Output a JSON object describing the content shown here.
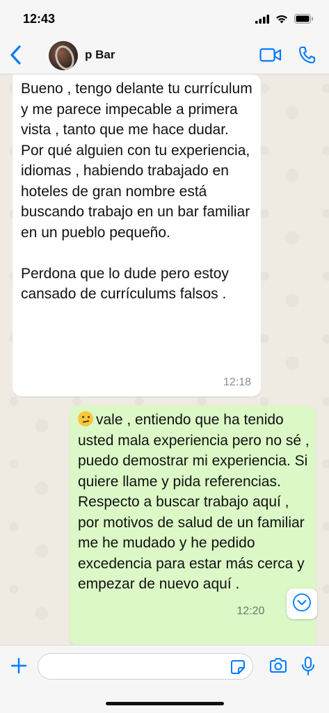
{
  "status_bar": {
    "time": "12:43"
  },
  "header": {
    "contact_name": "p Bar"
  },
  "messages": [
    {
      "direction": "incoming",
      "text": "Bueno , tengo delante tu currículum y me parece impecable a primera vista , tanto que me hace dudar.\nPor qué alguien con tu experiencia, idiomas , habiendo trabajado en hoteles de gran nombre está buscando trabajo en un bar familiar en un pueblo pequeño.\n\nPerdona que lo dude pero estoy cansado de currículums falsos .",
      "time": "12:18"
    },
    {
      "direction": "outgoing",
      "emoji": "confused-face",
      "text": "vale , entiendo que ha tenido usted mala experiencia pero no sé , puedo demostrar mi experiencia. Si quiere llame y pida referencias.\nRespecto a buscar trabajo aquí , por motivos de salud de un familiar me he mudado y he pedido excedencia para estar más cerca y empezar de nuevo aquí .",
      "time": "12:20",
      "status": "read-double-check"
    }
  ],
  "composer": {
    "value": "",
    "placeholder": ""
  },
  "colors": {
    "accent": "#007aff",
    "outgoing_bubble": "#dbf8c6",
    "incoming_bubble": "#ffffff",
    "chat_background": "#efeae2"
  },
  "icons": [
    "signal-icon",
    "wifi-icon",
    "battery-icon",
    "back-chevron-icon",
    "video-call-icon",
    "phone-call-icon",
    "scroll-down-icon",
    "plus-icon",
    "sticker-icon",
    "camera-icon",
    "microphone-icon",
    "double-check-icon"
  ]
}
